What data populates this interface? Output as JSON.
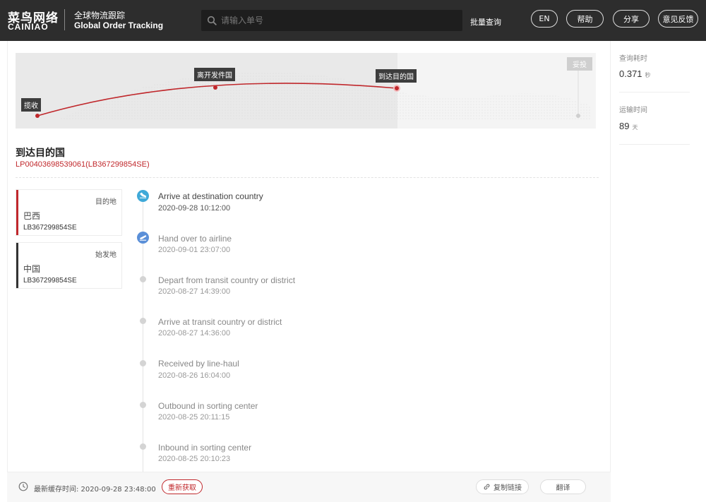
{
  "header": {
    "logo_cn": "菜鸟网络",
    "logo_en": "CAINIAO",
    "title_cn": "全球物流跟踪",
    "title_en": "Global Order Tracking",
    "search_placeholder": "请输入单号",
    "search_value": "",
    "batch_query": "批量查询",
    "buttons": [
      "EN",
      "帮助",
      "分享",
      "意见反馈"
    ],
    "icons": {
      "search": "search-icon"
    }
  },
  "map": {
    "labels": {
      "collect": "揽收",
      "depart_origin": "离开发件国",
      "arrive_destination": "到达目的国",
      "delivered": "妥投"
    }
  },
  "status": {
    "title": "到达目的国",
    "tracking_number": "LP00403698539061(LB367299854SE)"
  },
  "cards": [
    {
      "label": "目的地",
      "country": "巴西",
      "code": "LB367299854SE",
      "bar_color": "#c0282c"
    },
    {
      "label": "始发地",
      "country": "中国",
      "code": "LB367299854SE",
      "bar_color": "#333333"
    }
  ],
  "timeline": [
    {
      "event": "Arrive at destination country",
      "time": "2020-09-28 10:12:00",
      "icon": "plane-landing-icon"
    },
    {
      "event": "Hand over to airline",
      "time": "2020-09-01 23:07:00",
      "icon": "plane-takeoff-icon"
    },
    {
      "event": "Depart from transit country or district",
      "time": "2020-08-27 14:39:00"
    },
    {
      "event": "Arrive at transit country or district",
      "time": "2020-08-27 14:36:00"
    },
    {
      "event": "Received by line-haul",
      "time": "2020-08-26 16:04:00"
    },
    {
      "event": "Outbound in sorting center",
      "time": "2020-08-25 20:11:15"
    },
    {
      "event": "Inbound in sorting center",
      "time": "2020-08-25 20:10:23"
    }
  ],
  "stats": {
    "query_time_label": "查询耗时",
    "query_time_value": "0.371",
    "query_time_unit": "秒",
    "transit_label": "运输时间",
    "transit_value": "89",
    "transit_unit": "天"
  },
  "bottom": {
    "cache_text": "最新缓存时间: 2020-09-28 23:48:00",
    "refresh": "重新获取",
    "copy_link": "复制链接",
    "translate": "翻译"
  },
  "colors": {
    "accent": "#c0282c",
    "header_bg": "#2d2d2d",
    "first_icon": "#3fa9d8",
    "second_icon": "#5a8fd8"
  }
}
